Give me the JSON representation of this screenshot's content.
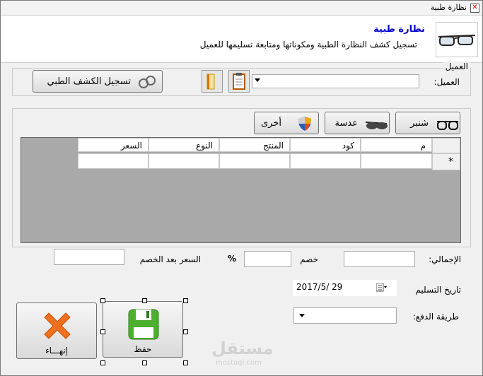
{
  "window": {
    "title": "نظارة طبية",
    "close_glyph": "✕"
  },
  "header": {
    "title": "نظارة طبية",
    "subtitle": "تسجيل كشف النظارة الطبية ومكوناتها ومتابعة تسليمها للعميل"
  },
  "client_group": {
    "caption": "العميل",
    "client_label": "العميل:",
    "client_value": "",
    "register_button": "تسجيل الكشف الطبي"
  },
  "product_tabs": [
    {
      "label": "شنبر",
      "icon": "frame-glasses-icon"
    },
    {
      "label": "عدسة",
      "icon": "lens-glasses-icon"
    },
    {
      "label": "أخرى",
      "icon": "shield-icon"
    }
  ],
  "grid": {
    "columns": [
      "م",
      "كود",
      "المنتج",
      "النوع",
      "السعر"
    ],
    "new_row_marker": "*"
  },
  "totals": {
    "total_label": "الإجمالي:",
    "total_value": "",
    "discount_label": "خصم",
    "discount_value": "",
    "percent_sign": "%",
    "net_label": "السعر بعد الخصم",
    "net_value": ""
  },
  "delivery": {
    "date_label": "تاريخ التسليم",
    "date_value": "2017/5/ 29"
  },
  "payment": {
    "label": "طريقة الدفع:",
    "value": ""
  },
  "actions": {
    "save_label": "حفظ",
    "close_label": "إنهـــاء"
  },
  "watermark": {
    "arabic": "مستقل",
    "latin": "mostaql.com"
  }
}
